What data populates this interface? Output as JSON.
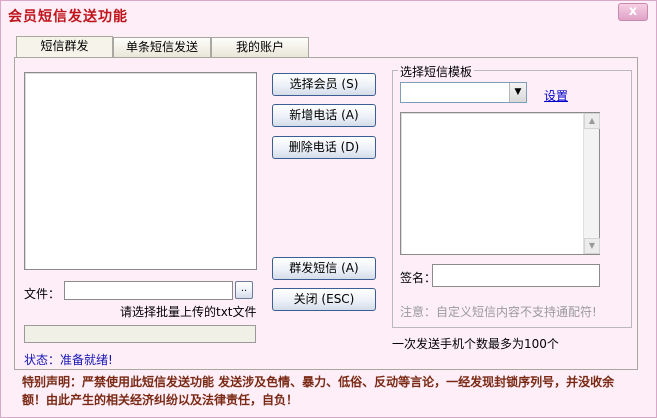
{
  "window": {
    "title": "会员短信发送功能",
    "close_label": "x"
  },
  "tabs": [
    {
      "label": "短信群发",
      "active": true
    },
    {
      "label": "单条短信发送",
      "active": false
    },
    {
      "label": "我的账户",
      "active": false
    }
  ],
  "file": {
    "label": "文件：",
    "value": "",
    "browse_label": "..",
    "hint": "请选择批量上传的txt文件"
  },
  "buttons": {
    "select_member": "选择会员 (S)",
    "add_phone": "新增电话 (A)",
    "delete_phone": "删除电话 (D)",
    "send_group": "群发短信 (A)",
    "close": "关闭 (ESC)"
  },
  "template": {
    "group_title": "选择短信模板",
    "selected": "",
    "settings_link": "设置",
    "signature_label": "签名：",
    "signature_value": "",
    "note": "注意：自定义短信内容不支持通配符!"
  },
  "limit_text": "一次发送手机个数最多为100个",
  "progress": 0,
  "status": "状态：准备就绪!",
  "disclaimer": "特别声明：严禁使用此短信发送功能 发送涉及色情、暴力、低俗、反动等言论，一经发现封锁序列号，并没收余额！由此产生的相关经济纠纷以及法律责任，自负！",
  "colors": {
    "title": "#c0141a",
    "status": "#1414b4",
    "disclaimer": "#7a2a14",
    "background": "#fdeef8"
  }
}
